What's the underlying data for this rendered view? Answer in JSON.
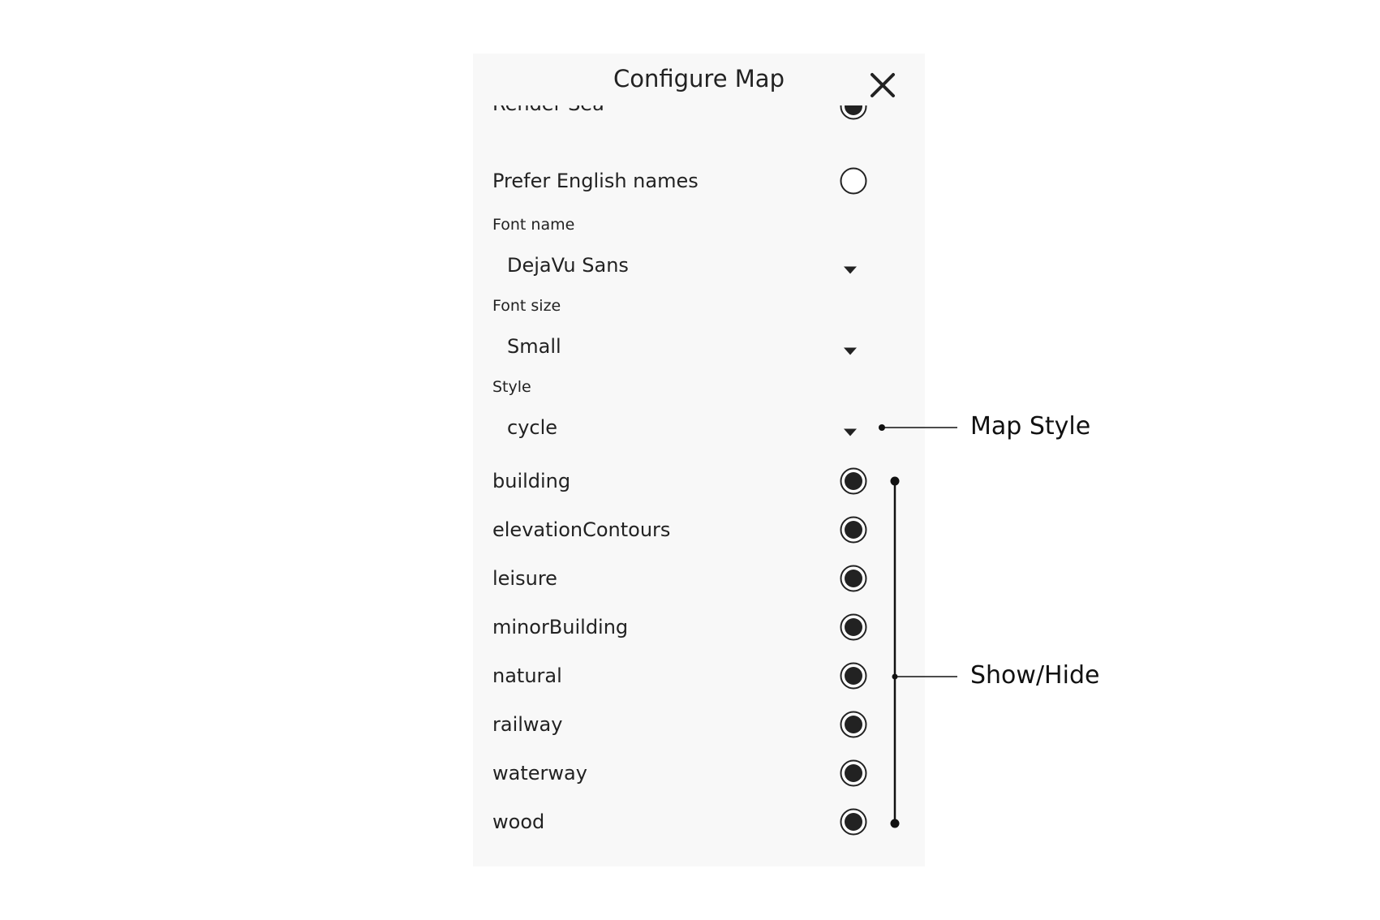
{
  "dialog": {
    "title": "Configure Map",
    "close_icon": "close-icon"
  },
  "partial_option": {
    "label": "Render Sea",
    "checked": true
  },
  "prefer_english": {
    "label": "Prefer English names",
    "checked": false
  },
  "font_name": {
    "label": "Font name",
    "value": "DejaVu Sans"
  },
  "font_size": {
    "label": "Font size",
    "value": "Small"
  },
  "style": {
    "label": "Style",
    "value": "cycle"
  },
  "layers": [
    {
      "label": "building",
      "checked": true
    },
    {
      "label": "elevationContours",
      "checked": true
    },
    {
      "label": "leisure",
      "checked": true
    },
    {
      "label": "minorBuilding",
      "checked": true
    },
    {
      "label": "natural",
      "checked": true
    },
    {
      "label": "railway",
      "checked": true
    },
    {
      "label": "waterway",
      "checked": true
    },
    {
      "label": "wood",
      "checked": true
    }
  ],
  "annotations": {
    "map_style": "Map Style",
    "show_hide": "Show/Hide"
  },
  "colors": {
    "panel_bg": "#f8f8f8",
    "radio_fill": "#222222",
    "text": "#222222"
  }
}
